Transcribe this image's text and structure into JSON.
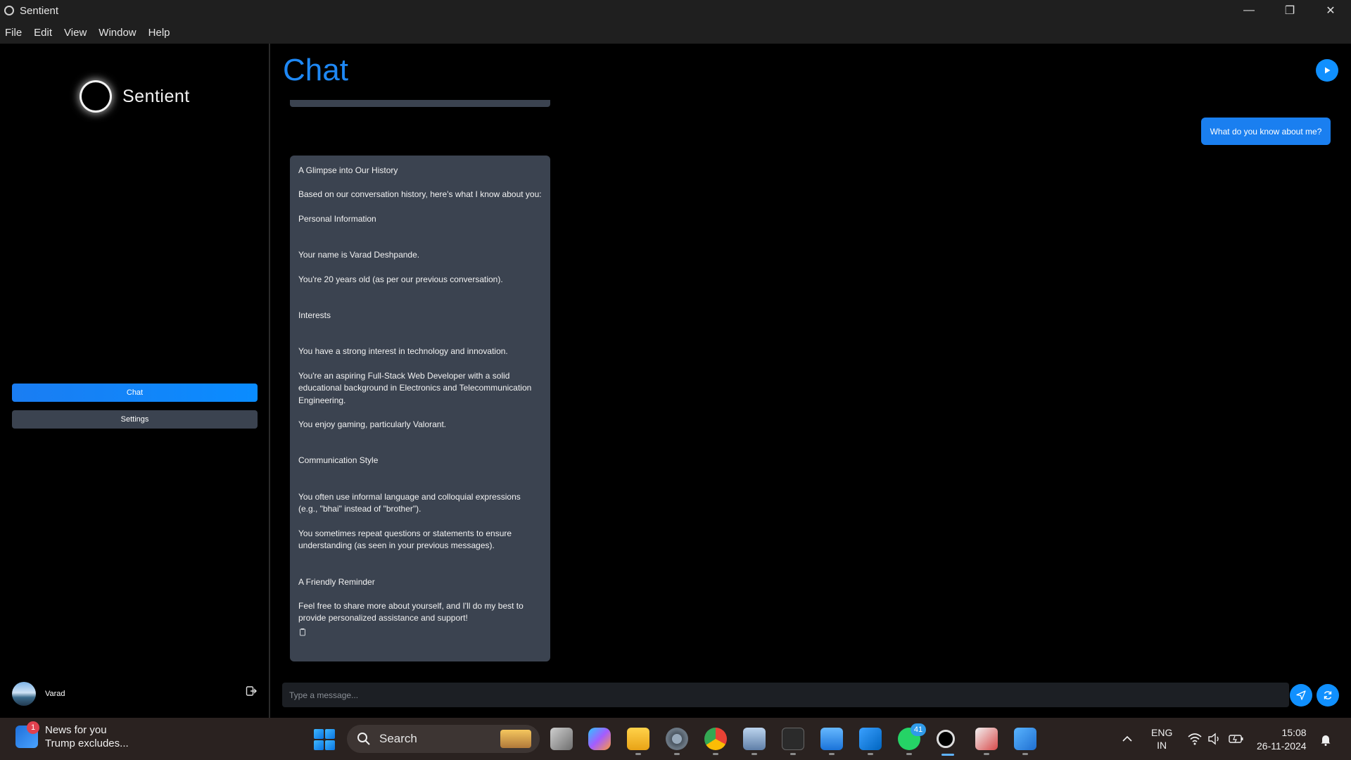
{
  "window": {
    "title": "Sentient",
    "menu": [
      "File",
      "Edit",
      "View",
      "Window",
      "Help"
    ]
  },
  "sidebar": {
    "brand": "Sentient",
    "nav": {
      "chat": "Chat",
      "settings": "Settings"
    },
    "user": {
      "name": "Varad"
    }
  },
  "main": {
    "title": "Chat",
    "user_message": "What do you know about me?",
    "bot_message": {
      "heading": "A Glimpse into Our History",
      "intro": "Based on our conversation history, here's what I know about you:",
      "s1_title": "Personal Information",
      "s1_items": [
        "Your name is Varad Deshpande.",
        "You're 20 years old (as per our previous conversation)."
      ],
      "s2_title": "Interests",
      "s2_items": [
        "You have a strong interest in technology and innovation.",
        "You're an aspiring Full-Stack Web Developer with a solid educational background in Electronics and Telecommunication Engineering.",
        "You enjoy gaming, particularly Valorant."
      ],
      "s3_title": "Communication Style",
      "s3_items": [
        "You often use informal language and colloquial expressions (e.g., \"bhai\" instead of \"brother\").",
        "You sometimes repeat questions or statements to ensure understanding (as seen in your previous messages)."
      ],
      "s4_title": "A Friendly Reminder",
      "closing": "Feel free to share more about yourself, and I'll do my best to provide personalized assistance and support!"
    },
    "input": {
      "placeholder": "Type a message..."
    }
  },
  "taskbar": {
    "news": {
      "title": "News for you",
      "headline": "Trump excludes...",
      "badge": "1"
    },
    "search_label": "Search",
    "whatsapp_badge": "41",
    "lang_top": "ENG",
    "lang_bottom": "IN",
    "time": "15:08",
    "date": "26-11-2024"
  },
  "colors": {
    "accent": "#1a7ff0",
    "bubble": "#3b4350",
    "title_blue": "#1e88f5"
  }
}
